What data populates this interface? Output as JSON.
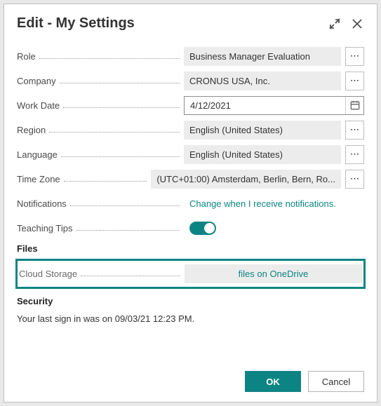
{
  "titlebar": {
    "title": "Edit - My Settings"
  },
  "fields": {
    "role": {
      "label": "Role",
      "value": "Business Manager Evaluation"
    },
    "company": {
      "label": "Company",
      "value": "CRONUS USA, Inc."
    },
    "workdate": {
      "label": "Work Date",
      "value": "4/12/2021"
    },
    "region": {
      "label": "Region",
      "value": "English (United States)"
    },
    "language": {
      "label": "Language",
      "value": "English (United States)"
    },
    "timezone": {
      "label": "Time Zone",
      "value": "(UTC+01:00) Amsterdam, Berlin, Bern, Ro..."
    },
    "notifications": {
      "label": "Notifications",
      "link": "Change when I receive notifications."
    },
    "teachingtips": {
      "label": "Teaching Tips",
      "on": true
    },
    "cloudstorage": {
      "label": "Cloud Storage",
      "value": "files on OneDrive"
    }
  },
  "sections": {
    "files": "Files",
    "security": "Security"
  },
  "security_text": "Your last sign in was on 09/03/21 12:23 PM.",
  "buttons": {
    "ok": "OK",
    "cancel": "Cancel"
  },
  "ellipsis": "⋯"
}
